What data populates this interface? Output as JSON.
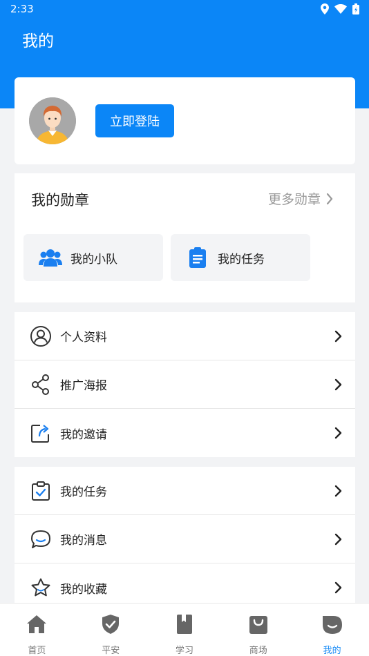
{
  "status_bar": {
    "time": "2:33"
  },
  "header": {
    "title": "我的"
  },
  "profile": {
    "login_label": "立即登陆"
  },
  "medals": {
    "title": "我的勋章",
    "more_label": "更多勋章",
    "tiles": [
      {
        "label": "我的小队",
        "icon": "team-icon"
      },
      {
        "label": "我的任务",
        "icon": "clipboard-icon"
      }
    ]
  },
  "menu_group_1": [
    {
      "label": "个人资料",
      "icon": "user-circle-icon"
    },
    {
      "label": "推广海报",
      "icon": "share-icon"
    },
    {
      "label": "我的邀请",
      "icon": "invite-icon"
    }
  ],
  "menu_group_2": [
    {
      "label": "我的任务",
      "icon": "task-check-icon"
    },
    {
      "label": "我的消息",
      "icon": "message-icon"
    },
    {
      "label": "我的收藏",
      "icon": "star-icon"
    }
  ],
  "tabbar": {
    "tabs": [
      {
        "label": "首页",
        "icon": "home-icon"
      },
      {
        "label": "平安",
        "icon": "shield-icon"
      },
      {
        "label": "学习",
        "icon": "book-icon"
      },
      {
        "label": "商场",
        "icon": "shopping-bag-icon"
      },
      {
        "label": "我的",
        "icon": "me-icon"
      }
    ],
    "active_index": 4,
    "active_color": "#1a8cf6"
  },
  "colors": {
    "primary": "#0b86f7",
    "background": "#f2f3f5"
  }
}
